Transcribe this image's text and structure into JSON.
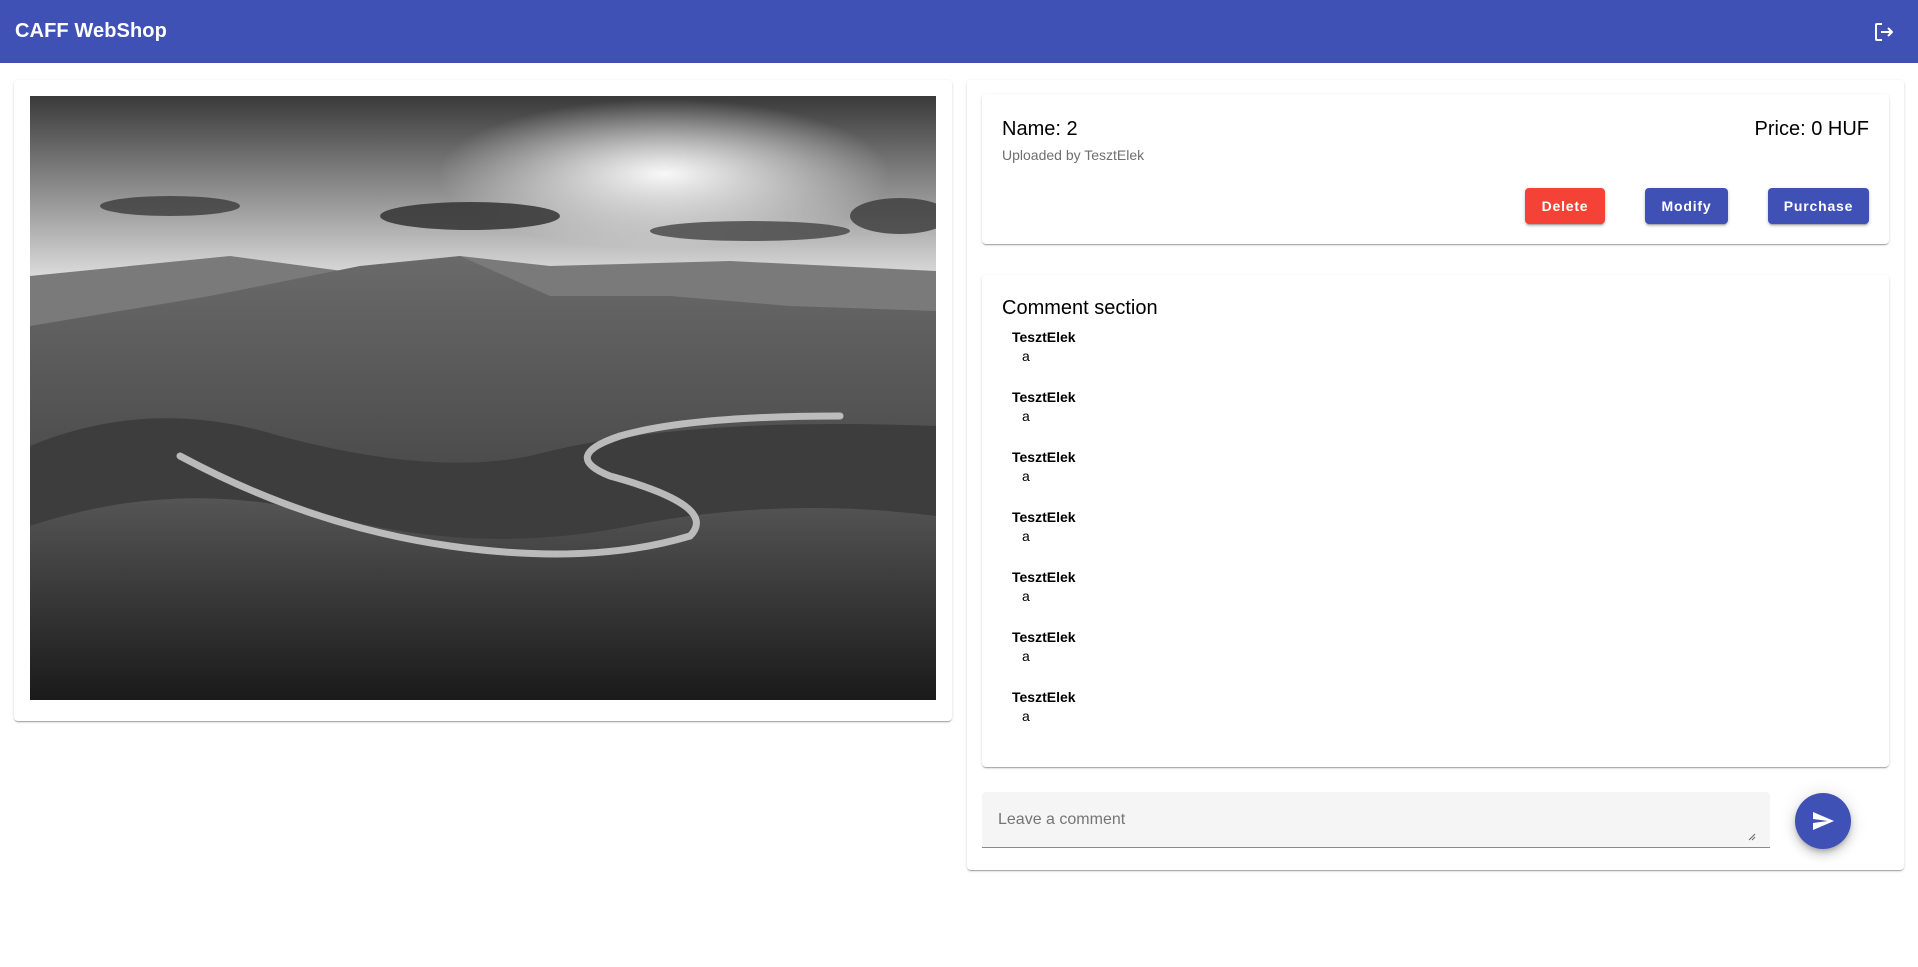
{
  "app": {
    "title": "CAFF WebShop",
    "logout_icon": "logout-icon",
    "accent_color": "#3f51b5"
  },
  "product": {
    "name_text": "Name: 2",
    "uploader_text": "Uploaded by TesztElek",
    "price_text": "Price: 0 HUF",
    "image_description_icon": "landscape-image"
  },
  "actions": {
    "delete_label": "Delete",
    "modify_label": "Modify",
    "purchase_label": "Purchase",
    "delete_color": "#f44336"
  },
  "comments": {
    "title": "Comment section",
    "items": [
      {
        "author": "TesztElek",
        "text": "a"
      },
      {
        "author": "TesztElek",
        "text": "a"
      },
      {
        "author": "TesztElek",
        "text": "a"
      },
      {
        "author": "TesztElek",
        "text": "a"
      },
      {
        "author": "TesztElek",
        "text": "a"
      },
      {
        "author": "TesztElek",
        "text": "a"
      },
      {
        "author": "TesztElek",
        "text": "a"
      }
    ]
  },
  "comment_input": {
    "placeholder": "Leave a comment",
    "value": "",
    "send_icon": "send-icon"
  }
}
